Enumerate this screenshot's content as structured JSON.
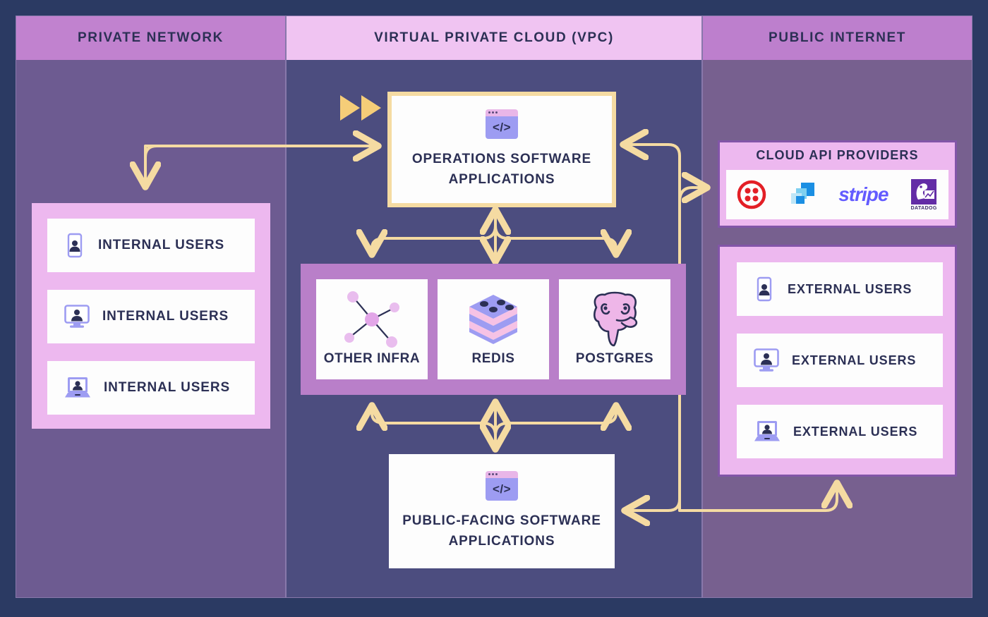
{
  "columns": [
    {
      "id": "private-network",
      "title": "PRIVATE NETWORK"
    },
    {
      "id": "vpc",
      "title": "VIRTUAL PRIVATE CLOUD (VPC)"
    },
    {
      "id": "public-internet",
      "title": "PUBLIC INTERNET"
    }
  ],
  "internal_users": {
    "rows": [
      {
        "label": "INTERNAL USERS",
        "icon": "mobile-user-icon"
      },
      {
        "label": "INTERNAL USERS",
        "icon": "desktop-user-icon"
      },
      {
        "label": "INTERNAL USERS",
        "icon": "laptop-user-icon"
      }
    ]
  },
  "external_users": {
    "rows": [
      {
        "label": "EXTERNAL USERS",
        "icon": "mobile-user-icon"
      },
      {
        "label": "EXTERNAL USERS",
        "icon": "desktop-user-icon"
      },
      {
        "label": "EXTERNAL USERS",
        "icon": "laptop-user-icon"
      }
    ]
  },
  "ops_app": {
    "line1": "OPERATIONS SOFTWARE",
    "line2": "APPLICATIONS",
    "icon": "code-window-icon",
    "icon_glyph": "</>"
  },
  "public_app": {
    "line1": "PUBLIC-FACING SOFTWARE",
    "line2": "APPLICATIONS",
    "icon": "code-window-icon",
    "icon_glyph": "</>"
  },
  "infrastructure": {
    "items": [
      {
        "label": "OTHER INFRA",
        "icon": "network-nodes-icon"
      },
      {
        "label": "REDIS",
        "icon": "redis-cube-icon"
      },
      {
        "label": "POSTGRES",
        "icon": "postgres-elephant-icon"
      }
    ]
  },
  "cloud_api": {
    "title": "CLOUD API PROVIDERS",
    "providers": [
      {
        "name": "twilio",
        "icon": "twilio-logo"
      },
      {
        "name": "blue-squares",
        "icon": "blue-squares-logo"
      },
      {
        "name": "stripe",
        "icon": "stripe-logo",
        "wordmark": "stripe"
      },
      {
        "name": "datadog",
        "icon": "datadog-logo",
        "wordmark": "DATADOG"
      }
    ]
  },
  "colors": {
    "page_background": "#2b3a63",
    "private_column": "#6d5b91",
    "vpc_column": "#4c4d7f",
    "public_column": "#77608f",
    "header_private": "#c182cf",
    "header_vpc": "#f0c4f2",
    "header_public": "#bd7fcd",
    "panel_pink": "#edb8ef",
    "infra_band": "#b97fc9",
    "arrow": "#f5dba2",
    "ops_border": "#f5dba2",
    "text_dark": "#2c3055",
    "card_white": "#fdfdfd",
    "twilio_red": "#e31f26",
    "stripe_purple": "#635bff",
    "datadog_purple": "#632ca6",
    "redis_blue": "#9d9cf2",
    "redis_pink": "#f6c2e5",
    "postgres_pink": "#eeb6e8"
  },
  "decor": {
    "play_arrows": "double-triangle-play-icon"
  }
}
